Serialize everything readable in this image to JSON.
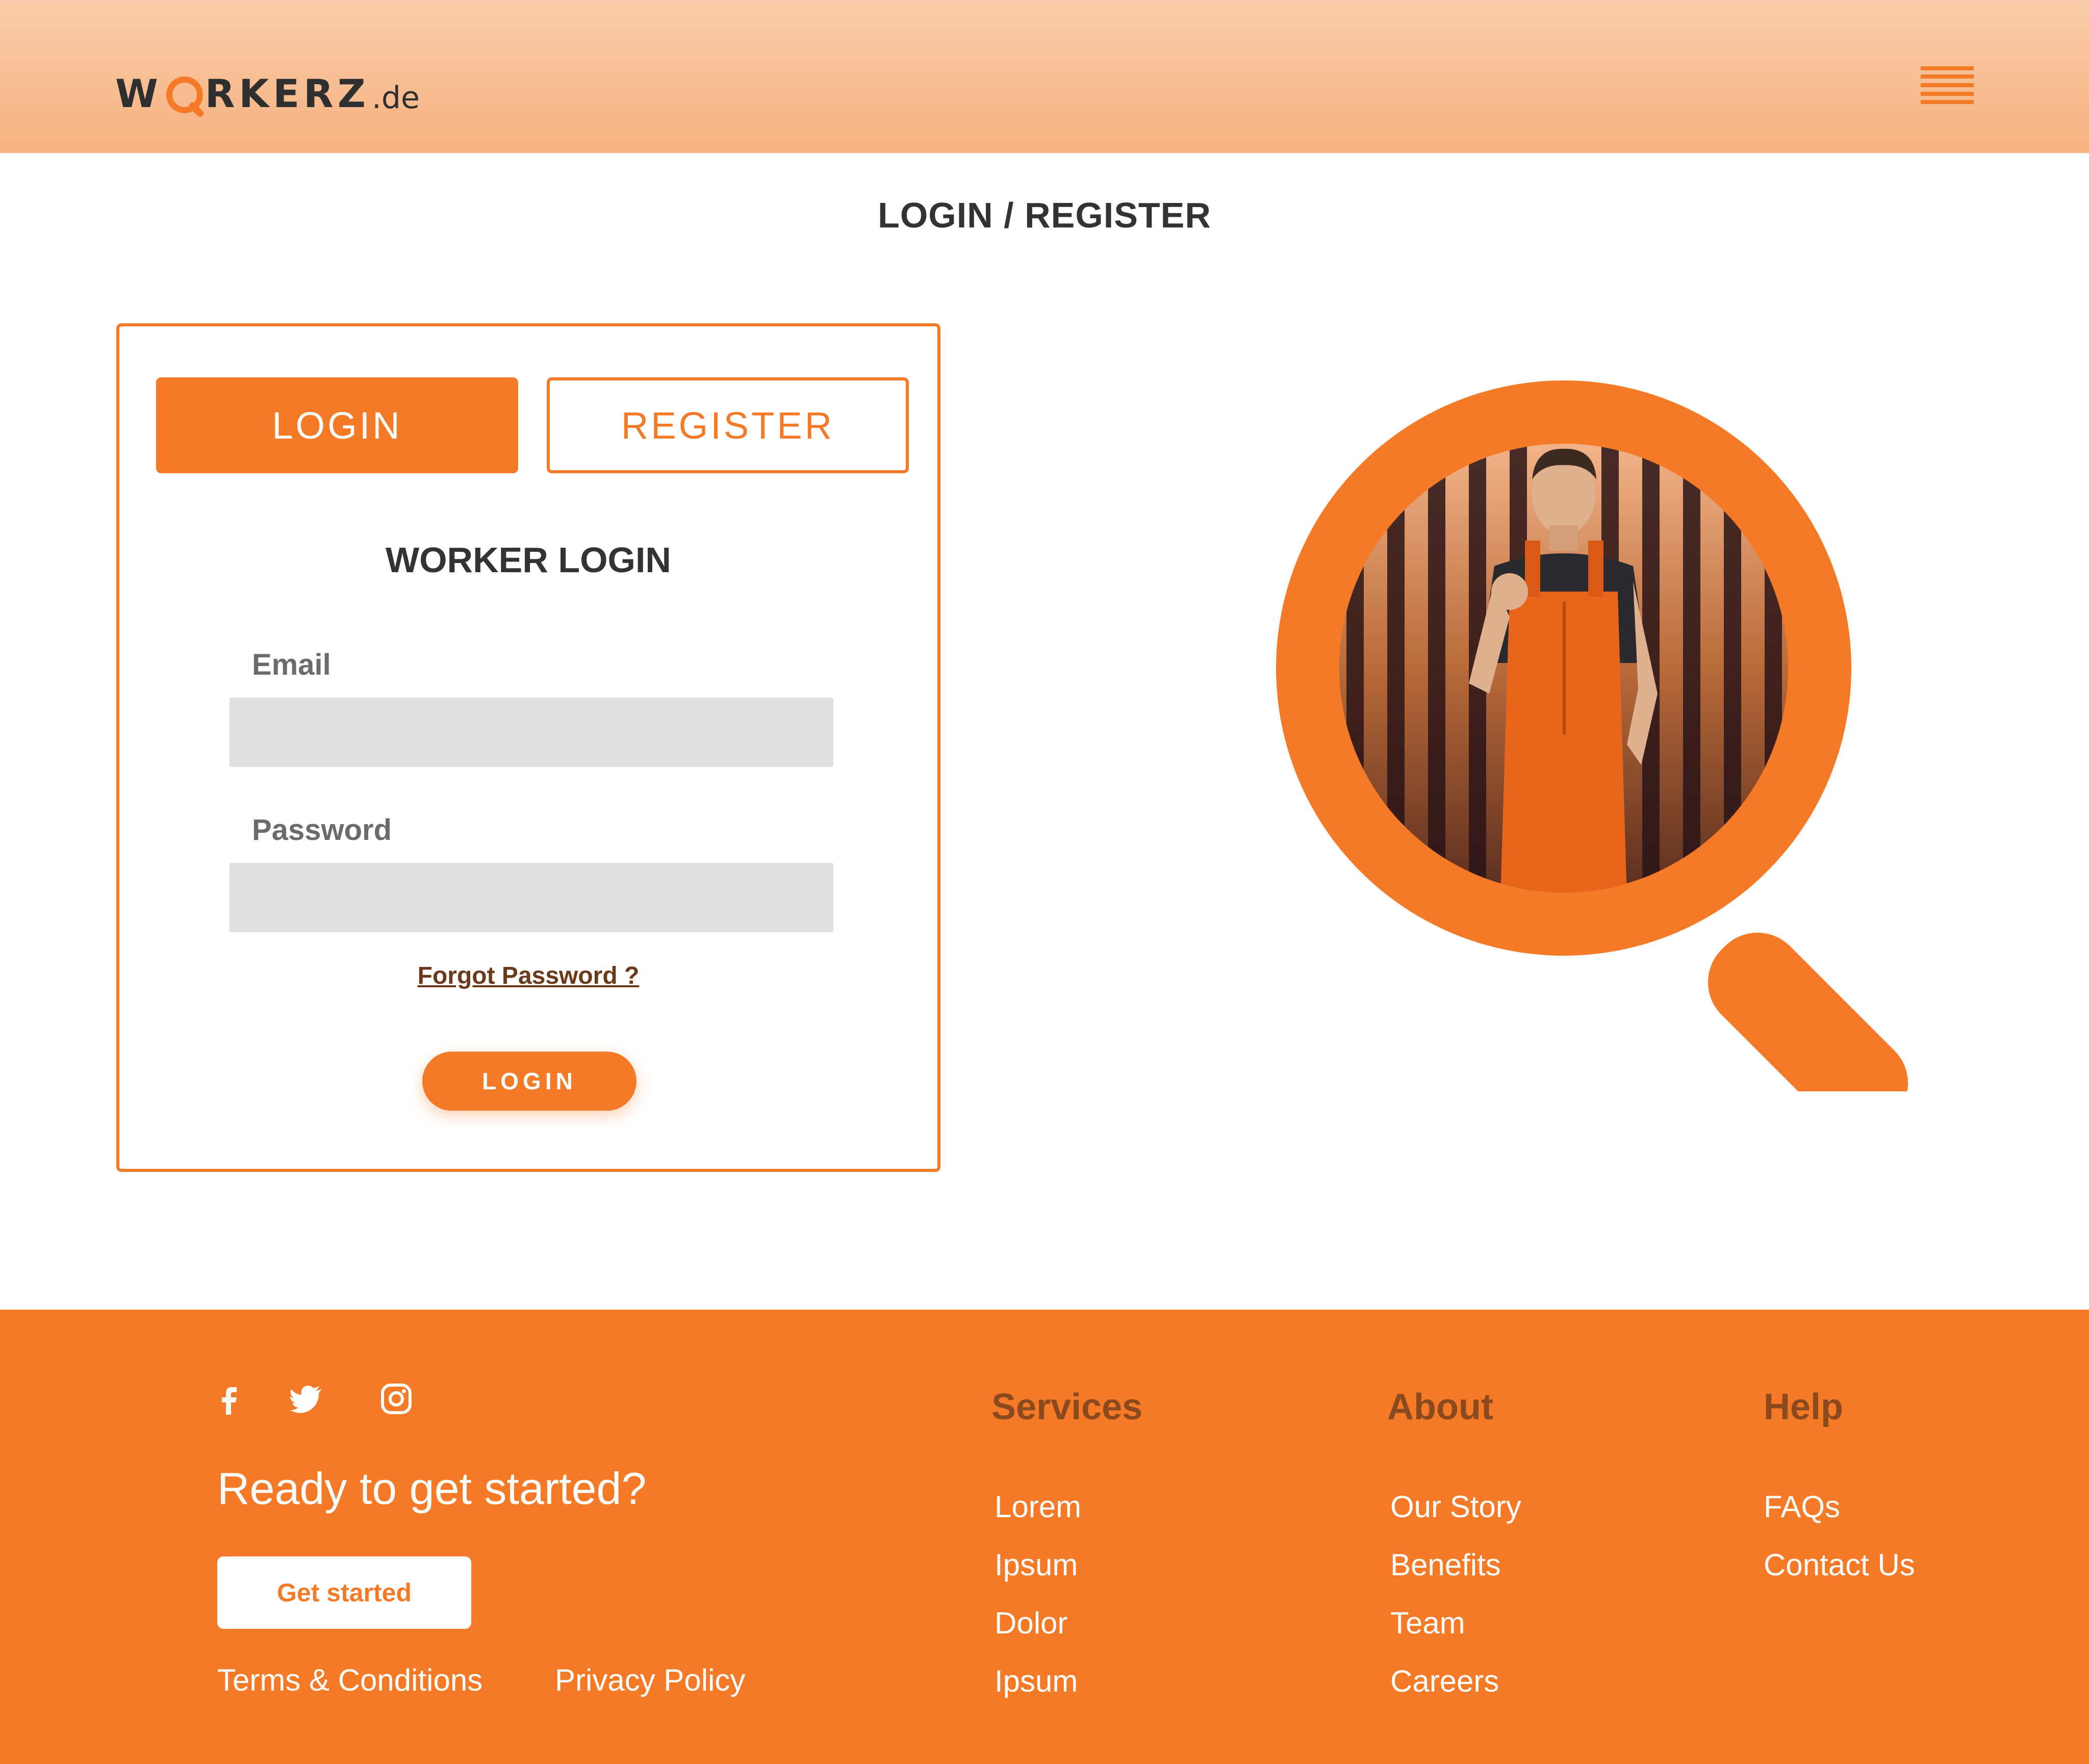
{
  "header": {
    "logo_main_1": "W",
    "logo_main_2": "RKERZ",
    "logo_sub": ".de",
    "menu_icon": "hamburger-icon"
  },
  "page_title": "LOGIN / REGISTER",
  "card": {
    "tab_login": "LOGIN",
    "tab_register": "REGISTER",
    "heading": "WORKER LOGIN",
    "email_label": "Email",
    "email_value": "",
    "password_label": "Password",
    "password_value": "",
    "forgot": "Forgot Password ?",
    "submit": "LOGIN"
  },
  "illustration": {
    "icon": "magnifier-with-worker-photo"
  },
  "footer": {
    "social": [
      "facebook-icon",
      "twitter-icon",
      "instagram-icon"
    ],
    "cta_text": "Ready to get started?",
    "cta_button": "Get started",
    "terms": "Terms & Conditions",
    "privacy": "Privacy Policy",
    "columns": [
      {
        "heading": "Services",
        "links": [
          "Lorem",
          "Ipsum",
          "Dolor",
          "Ipsum"
        ]
      },
      {
        "heading": "About",
        "links": [
          "Our Story",
          "Benefits",
          "Team",
          "Careers"
        ]
      },
      {
        "heading": "Help",
        "links": [
          "FAQs",
          "Contact Us"
        ]
      }
    ]
  },
  "colors": {
    "accent": "#f47a28",
    "header_top": "#f8ccaa",
    "header_bottom": "#f7b280",
    "text_dark": "#333333",
    "footer_heading": "#8a4a1e",
    "input_bg": "#e0e0e0"
  }
}
